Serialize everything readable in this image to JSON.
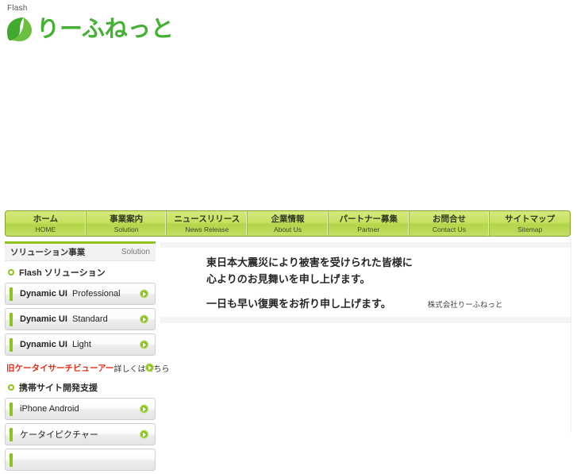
{
  "header": {
    "flash_label": "Flash",
    "logo_text": "りーふねっと",
    "logo_icon": "leaf-icon",
    "brand_color": "#45b035"
  },
  "gnav": {
    "items": [
      {
        "ja": "ホーム",
        "en": "HOME"
      },
      {
        "ja": "事業案内",
        "en": "Solution"
      },
      {
        "ja": "ニュースリリース",
        "en": "News Release"
      },
      {
        "ja": "企業情報",
        "en": "About Us"
      },
      {
        "ja": "パートナー募集",
        "en": "Partner"
      },
      {
        "ja": "お問合せ",
        "en": "Contact Us"
      },
      {
        "ja": "サイトマップ",
        "en": "Sitemap"
      }
    ]
  },
  "sidebar": {
    "title_ja": "ソリューション事業",
    "title_en": "Solution",
    "group1_label": "Flash ソリューション",
    "group1_icon": "ring-bullet-icon",
    "items1": [
      {
        "bold": "Dynamic UI",
        "rest": "Professional",
        "arrow_icon": "arrow-right-circle-icon"
      },
      {
        "bold": "Dynamic UI",
        "rest": "Standard",
        "arrow_icon": "arrow-right-circle-icon"
      },
      {
        "bold": "Dynamic UI",
        "rest": "Light",
        "arrow_icon": "arrow-right-circle-icon"
      }
    ],
    "legacy_link": {
      "title": "旧ケータイサーチビューアー",
      "more": "詳しくはこちら",
      "arrow_icon": "arrow-right-circle-icon",
      "color": "#e22d17"
    },
    "group2_label": "携帯サイト開発支援",
    "group2_icon": "ring-bullet-icon",
    "items2": [
      {
        "bold": "",
        "rest": "iPhone  Android",
        "arrow_icon": "arrow-right-circle-icon"
      },
      {
        "bold": "",
        "rest": "ケータイピクチャー",
        "arrow_icon": "arrow-right-circle-icon"
      }
    ]
  },
  "main": {
    "notice_line1": "東日本大震災により被害を受けられた皆様に",
    "notice_line2": "心よりのお見舞いを申し上げます。",
    "notice_line3": "一日も早い復興をお祈り申し上げます。",
    "signature": "株式会社りーふねっと"
  }
}
